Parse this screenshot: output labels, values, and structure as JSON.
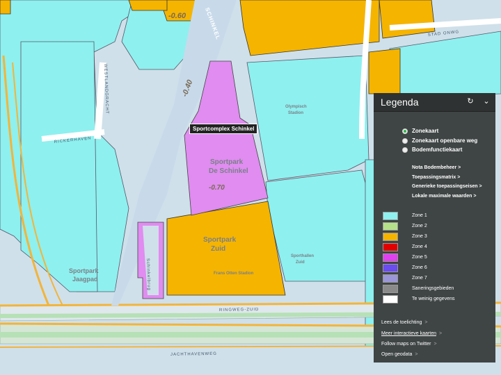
{
  "map": {
    "tooltip": "Sportcomplex Schinkel",
    "streets": {
      "schinkel": "SCHINKEL",
      "westlandgracht": "WESTLANDGRACHT",
      "rickerhaven": "RICKERHAVEN",
      "ringweg_zuid": "RINGWEG-ZUID",
      "stad_onwg": "STAD ONWG",
      "schinkelbrug": "Schinkelbrug",
      "jachthavenweg": "JACHTHAVENWEG"
    },
    "areas": {
      "sportpark_schinkel_line1": "Sportpark",
      "sportpark_schinkel_line2": "De Schinkel",
      "sportpark_zuid_line1": "Sportpark",
      "sportpark_zuid_line2": "Zuid",
      "frans_otten": "Frans Otten Stadion",
      "sportpark_jaagpad_line1": "Sportpark",
      "sportpark_jaagpad_line2": "Jaagpad",
      "olympisch_stadion_line1": "Olympisch",
      "olympisch_stadion_line2": "Stadion",
      "sporthallen_zuid_line1": "Sporthallen",
      "sporthallen_zuid_line2": "Zuid"
    },
    "values": {
      "top": "-0.60",
      "left": "-0.40",
      "center": "-0.70"
    }
  },
  "legend": {
    "title": "Legenda",
    "refresh_icon": "refresh-icon",
    "collapse_icon": "chevron-down-icon",
    "map_types": [
      {
        "label": "Zonekaart",
        "selected": true
      },
      {
        "label": "Zonekaart openbare weg",
        "selected": false
      },
      {
        "label": "Bodemfunctiekaart",
        "selected": false
      }
    ],
    "links": [
      "Nota Bodembeheer >",
      "Toepassingsmatrix >",
      "Generieke toepassingseisen >",
      "Lokale maximale waarden >"
    ],
    "zones": [
      {
        "label": "Zone 1",
        "color": "#8ff0f0"
      },
      {
        "label": "Zone 2",
        "color": "#b5e08a"
      },
      {
        "label": "Zone 3",
        "color": "#f5b400"
      },
      {
        "label": "Zone 4",
        "color": "#e00000"
      },
      {
        "label": "Zone 5",
        "color": "#e040f0"
      },
      {
        "label": "Zone 6",
        "color": "#6a4cf0"
      },
      {
        "label": "Zone 7",
        "color": "#9a96d8"
      },
      {
        "label": "Saneringsgebieden",
        "color": "#8a8a8a"
      },
      {
        "label": "Te weinig gegevens",
        "color": "#ffffff"
      }
    ],
    "footer": [
      {
        "label": "Lees de toelichting",
        "underline": false
      },
      {
        "label": "Meer interactieve kaarten",
        "underline": true
      },
      {
        "label": "Follow maps on Twitter",
        "underline": false
      },
      {
        "label": "Open geodata",
        "underline": false
      }
    ]
  }
}
